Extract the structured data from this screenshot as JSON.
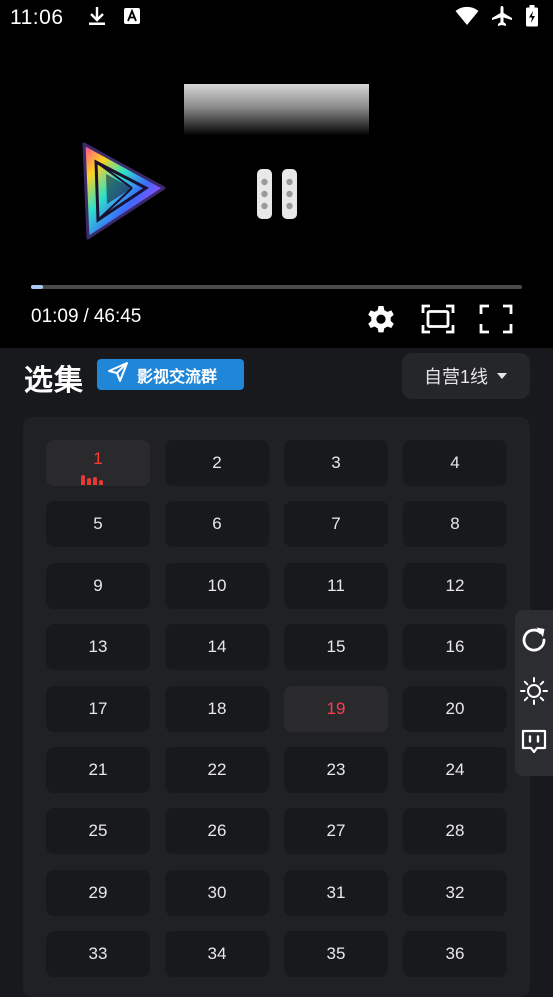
{
  "status_bar": {
    "time": "11:06",
    "left_icons": [
      "download-icon",
      "font-a-icon"
    ],
    "right_icons": [
      "wifi-icon",
      "airplane-icon",
      "battery-charging-icon"
    ]
  },
  "player": {
    "progress_fraction": 0.025,
    "current_time": "01:09",
    "separator": "/",
    "duration": "46:45",
    "controls": [
      "settings-icon",
      "screen-ratio-icon",
      "fullscreen-icon"
    ],
    "accent_color": "#a9c9ef"
  },
  "episodes": {
    "title": "选集",
    "group_badge": "影视交流群",
    "source_label": "自营1线",
    "playing_index": 0,
    "watched_index": 18,
    "playing_color": "#ff3b30",
    "items": [
      "1",
      "2",
      "3",
      "4",
      "5",
      "6",
      "7",
      "8",
      "9",
      "10",
      "11",
      "12",
      "13",
      "14",
      "15",
      "16",
      "17",
      "18",
      "19",
      "20",
      "21",
      "22",
      "23",
      "24",
      "25",
      "26",
      "27",
      "28",
      "29",
      "30",
      "31",
      "32",
      "33",
      "34",
      "35",
      "36"
    ]
  },
  "side_panel": {
    "icons": [
      "refresh-icon",
      "brightness-icon",
      "feedback-icon"
    ]
  }
}
